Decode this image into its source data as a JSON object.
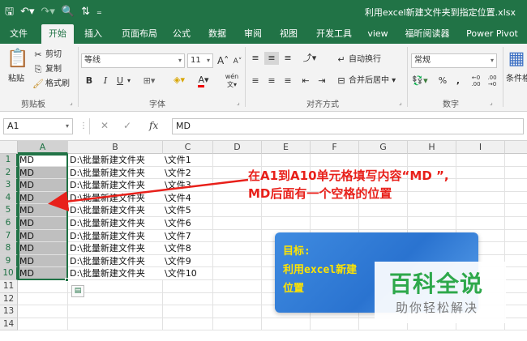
{
  "title_bar": {
    "save_icon": "save-icon",
    "undo_icon": "undo-icon",
    "redo_icon": "redo-icon",
    "print_preview_icon": "print-preview-icon",
    "sort_icon": "sort-icon",
    "customize_icon": "customize-qat-icon",
    "title": "利用excel新建文件夹到指定位置.xlsx"
  },
  "ribbon_tabs": [
    "文件",
    "开始",
    "插入",
    "页面布局",
    "公式",
    "数据",
    "审阅",
    "视图",
    "开发工具",
    "view",
    "福昕阅读器",
    "Power Pivot"
  ],
  "active_tab": "开始",
  "ribbon": {
    "clipboard": {
      "paste": "粘贴",
      "cut": "剪切",
      "copy": "复制",
      "format_painter": "格式刷",
      "group_label": "剪贴板"
    },
    "font": {
      "font_name": "等线",
      "font_size": "11",
      "bold": "B",
      "italic": "I",
      "underline": "U",
      "grow": "A",
      "shrink": "A",
      "font_color_letter": "A",
      "wen": "wén",
      "group_label": "字体"
    },
    "alignment": {
      "wrap_text": "自动换行",
      "merge_center": "合并后居中",
      "group_label": "对齐方式"
    },
    "number": {
      "format": "常规",
      "percent": "%",
      "comma": ",",
      "inc_decimal": "←0 .00",
      "dec_decimal": ".00 →0",
      "group_label": "数字"
    },
    "styles": {
      "conditional_format": "条件格"
    }
  },
  "formula_bar": {
    "name_box": "A1",
    "fx_label": "fx",
    "content": "MD"
  },
  "sheet": {
    "columns": [
      "A",
      "B",
      "C",
      "D",
      "E",
      "F",
      "G",
      "H",
      "I"
    ],
    "row_numbers": [
      "1",
      "2",
      "3",
      "4",
      "5",
      "6",
      "7",
      "8",
      "9",
      "10",
      "11",
      "12",
      "13",
      "14"
    ],
    "rows": [
      [
        "MD",
        "D:\\批量新建文件夹",
        "\\文件1"
      ],
      [
        "MD",
        "D:\\批量新建文件夹",
        "\\文件2"
      ],
      [
        "MD",
        "D:\\批量新建文件夹",
        "\\文件3"
      ],
      [
        "MD",
        "D:\\批量新建文件夹",
        "\\文件4"
      ],
      [
        "MD",
        "D:\\批量新建文件夹",
        "\\文件5"
      ],
      [
        "MD",
        "D:\\批量新建文件夹",
        "\\文件6"
      ],
      [
        "MD",
        "D:\\批量新建文件夹",
        "\\文件7"
      ],
      [
        "MD",
        "D:\\批量新建文件夹",
        "\\文件8"
      ],
      [
        "MD",
        "D:\\批量新建文件夹",
        "\\文件9"
      ],
      [
        "MD",
        "D:\\批量新建文件夹",
        "\\文件10"
      ]
    ]
  },
  "annotation": {
    "line1": "在A1到A10单元格填写内容“MD ”,",
    "line2": "MD后面有一个空格的位置"
  },
  "goal_box": {
    "line1": "目标:",
    "line2": "利用excel新建",
    "line3": "位置"
  },
  "watermark": {
    "title": "百科全说",
    "subtitle": "助你轻松解决"
  },
  "colors": {
    "excel_green": "#217346",
    "annotation_red": "#e8201a",
    "goal_blue": "#2a73d0",
    "goal_text_yellow": "#ffe400",
    "watermark_green": "#2ea84b"
  }
}
